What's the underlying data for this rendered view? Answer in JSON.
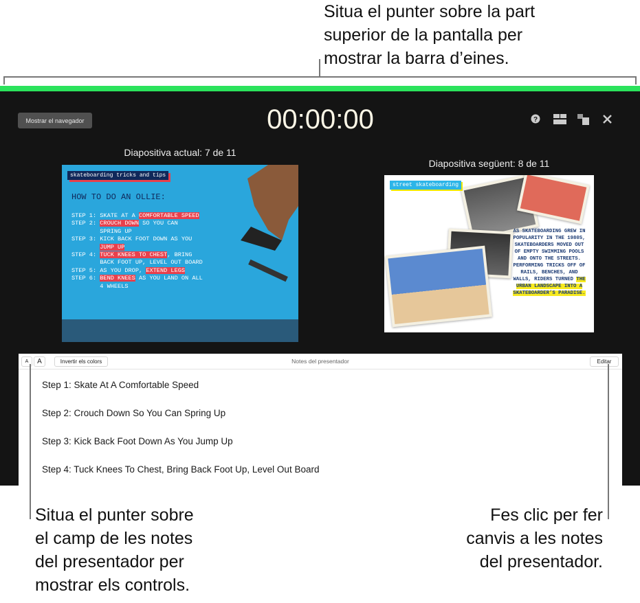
{
  "callouts": {
    "top": [
      "Situa el punter sobre la part",
      "superior de la pantalla per",
      "mostrar la barra d’eines."
    ],
    "left": [
      "Situa el punter sobre",
      "el camp de les notes",
      "del presentador per",
      "mostrar els controls."
    ],
    "right": [
      "Fes clic per fer",
      "canvis a les notes",
      "del presentador."
    ]
  },
  "toolbar": {
    "show_navigator": "Mostrar el navegador",
    "timer": "00:00:00",
    "icons": [
      "help-icon",
      "layout-icon",
      "swap-displays-icon",
      "close-icon"
    ]
  },
  "current_slide": {
    "label": "Diapositiva actual: 7 de 11",
    "tag": "skateboarding tricks and tips",
    "heading": "HOW TO DO AN OLLIE:",
    "steps": [
      [
        "STEP 1: SKATE AT A ",
        "COMFORTABLE SPEED",
        ""
      ],
      [
        "STEP 2: ",
        "CROUCH DOWN",
        " SO YOU CAN\n        SPRING UP"
      ],
      [
        "STEP 3: KICK BACK FOOT DOWN AS YOU\n        ",
        "JUMP UP",
        ""
      ],
      [
        "STEP 4: ",
        "TUCK KNEES TO CHEST",
        ", BRING\n        BACK FOOT UP, LEVEL OUT BOARD"
      ],
      [
        "STEP 5: AS YOU DROP, ",
        "EXTEND LEGS",
        ""
      ],
      [
        "STEP 6: ",
        "BEND KNEES",
        " AS YOU LAND ON ALL\n        4 WHEELS"
      ]
    ]
  },
  "next_slide": {
    "label": "Diapositiva següent: 8 de 11",
    "tag": "street skateboarding",
    "body": "AS SKATEBOARDING GREW IN POPULARITY IN THE 1980S, SKATEBOARDERS MOVED OUT OF EMPTY SWIMMING POOLS AND ONTO THE STREETS. PERFORMING TRICKS OFF OF RAILS, BENCHES, AND WALLS, RIDERS TURNED ",
    "highlight": "THE URBAN LANDSCAPE INTO A SKATEBOARDER’S PARADISE."
  },
  "notes": {
    "font_smaller": "A",
    "font_larger": "A",
    "invert": "Invertir els colors",
    "title": "Notes del presentador",
    "edit": "Editar",
    "lines": [
      "Step 1: Skate At A Comfortable Speed",
      "Step 2: Crouch Down So You Can Spring Up",
      "Step 3: Kick Back Foot Down As You Jump Up",
      "Step 4: Tuck Knees To Chest, Bring Back Foot Up, Level Out Board"
    ]
  },
  "colors": {
    "accent_green": "#2be35c",
    "background": "#141414",
    "highlight_red": "#e8404c",
    "highlight_yellow": "#f7ea1e"
  }
}
